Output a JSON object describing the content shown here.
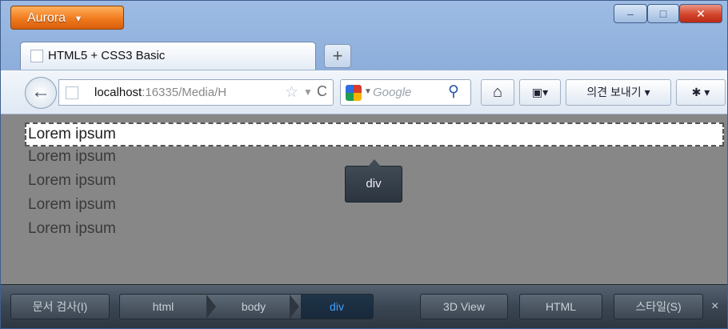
{
  "window": {
    "app_button": "Aurora",
    "caret": "▼",
    "min": "–",
    "max": "□",
    "close": "✕"
  },
  "tabs": [
    {
      "title": "HTML5 + CSS3 Basic"
    }
  ],
  "new_tab": "+",
  "navbar": {
    "back": "←",
    "url_host": "localhost",
    "url_path": ":16335/Media/H",
    "reload": "C",
    "search_placeholder": "Google",
    "report_button": "의견 보내기 ▾",
    "home": "⌂",
    "addon": "▣▾",
    "plugin": "✱ ▾"
  },
  "content": {
    "lines": [
      "Lorem ipsum",
      "Lorem ipsum",
      "Lorem ipsum",
      "Lorem ipsum",
      "Lorem ipsum"
    ],
    "tooltip": "div"
  },
  "inspector": {
    "inspect_button": "문서 검사(I)",
    "breadcrumbs": [
      "html",
      "body",
      "div"
    ],
    "selected_crumb": "div",
    "view3d_button": "3D View",
    "html_button": "HTML",
    "style_button": "스타일(S)",
    "close": "×"
  },
  "colors": {
    "app_button": "#f07a1e",
    "content_bg": "#878787",
    "inspector_bg": "#3b4653",
    "selected_crumb_text": "#3fa0ff"
  }
}
